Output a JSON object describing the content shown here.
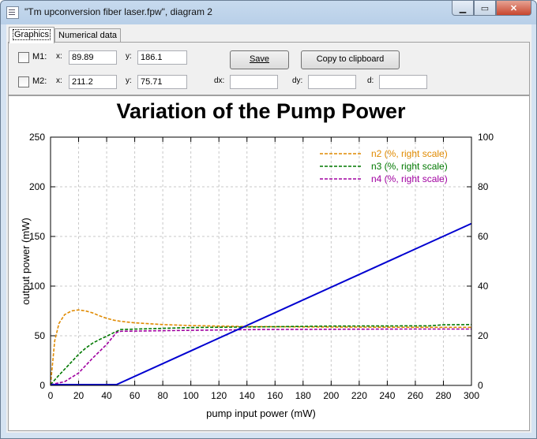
{
  "window": {
    "title": "\"Tm upconversion fiber laser.fpw\", diagram 2"
  },
  "tabs": [
    {
      "label": "Graphics"
    },
    {
      "label": "Numerical data"
    }
  ],
  "markers": {
    "m1": {
      "label": "M1:",
      "x_label": "x:",
      "x_value": "89.89",
      "y_label": "y:",
      "y_value": "186.1"
    },
    "m2": {
      "label": "M2:",
      "x_label": "x:",
      "x_value": "211.2",
      "y_label": "y:",
      "y_value": "75.71"
    }
  },
  "diff": {
    "dx_label": "dx:",
    "dx_value": "",
    "dy_label": "dy:",
    "dy_value": "",
    "d_label": "d:",
    "d_value": ""
  },
  "buttons": {
    "save": "Save",
    "copy": "Copy to clipboard"
  },
  "colors": {
    "n2": "#e08a00",
    "n3": "#007800",
    "n4": "#a000a0",
    "output": "#0000d0"
  },
  "chart_data": {
    "type": "line",
    "title": "Variation of the Pump Power",
    "xlabel": "pump input power (mW)",
    "ylabel": "output power (mW)",
    "xlim": [
      0,
      300
    ],
    "ylim": [
      0,
      250
    ],
    "y2lim": [
      0,
      100
    ],
    "xticks": [
      "0",
      "20",
      "40",
      "60",
      "80",
      "100",
      "120",
      "140",
      "160",
      "180",
      "200",
      "220",
      "240",
      "260",
      "280",
      "300"
    ],
    "yticks": [
      "0",
      "50",
      "100",
      "150",
      "200",
      "250"
    ],
    "y2ticks": [
      "0",
      "20",
      "40",
      "60",
      "80",
      "100"
    ],
    "grid": true,
    "legend_position": "top-right",
    "series": [
      {
        "name": "n2 (%, right scale)",
        "axis": "right",
        "style": "dashed",
        "color": "#e08a00",
        "x": [
          0,
          3,
          6,
          10,
          15,
          20,
          25,
          30,
          35,
          40,
          45,
          50,
          60,
          80,
          100,
          120,
          140,
          200,
          260,
          300
        ],
        "y": [
          0,
          18,
          25,
          28.5,
          30,
          30.4,
          30,
          29.2,
          28,
          27,
          26.3,
          25.8,
          25.2,
          24.5,
          24.1,
          23.9,
          23.7,
          23.5,
          23.4,
          23.4
        ]
      },
      {
        "name": "n3 (%, right scale)",
        "axis": "right",
        "style": "dashed",
        "color": "#007800",
        "x": [
          0,
          5,
          10,
          15,
          20,
          25,
          30,
          35,
          40,
          45,
          50,
          100,
          150,
          200,
          270,
          280,
          300
        ],
        "y": [
          0,
          3.5,
          6.5,
          9.5,
          12.5,
          15,
          17,
          18.5,
          19.8,
          21.2,
          22.5,
          23.3,
          23.6,
          23.9,
          24.0,
          24.4,
          24.5
        ]
      },
      {
        "name": "n4 (%, right scale)",
        "axis": "right",
        "style": "dashed",
        "color": "#a000a0",
        "x": [
          0,
          10,
          20,
          30,
          40,
          47,
          50,
          100,
          150,
          200,
          250,
          300
        ],
        "y": [
          0,
          1.5,
          5,
          11,
          16.5,
          21.3,
          21.8,
          22.2,
          22.5,
          22.6,
          22.7,
          22.7
        ]
      },
      {
        "name": "",
        "axis": "left",
        "style": "solid",
        "color": "#0000d0",
        "x": [
          0,
          47,
          300
        ],
        "y": [
          0,
          0,
          163
        ]
      }
    ]
  }
}
